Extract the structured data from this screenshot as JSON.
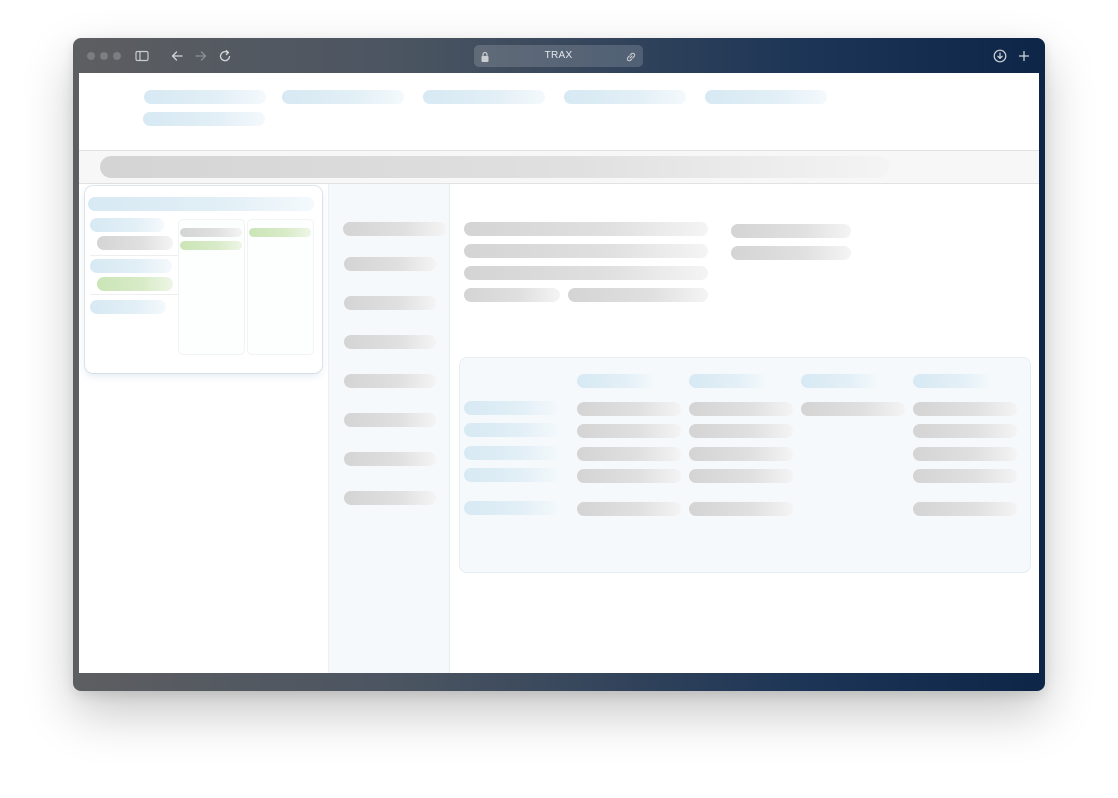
{
  "browser": {
    "address_text": "TRAX",
    "icons": [
      "sidebar-toggle-icon",
      "back-arrow-icon",
      "forward-arrow-icon",
      "reload-icon",
      "lock-icon",
      "link-icon",
      "download-icon",
      "new-tab-icon"
    ]
  },
  "colors": {
    "frame_gradient_start": "#5d5e61",
    "frame_gradient_end": "#0d2647",
    "skeleton_gray": "#d4d4d4",
    "skeleton_blue": "#d7e9f3",
    "skeleton_green": "#cbe5b6",
    "panel_tint": "#f5f9fc"
  }
}
